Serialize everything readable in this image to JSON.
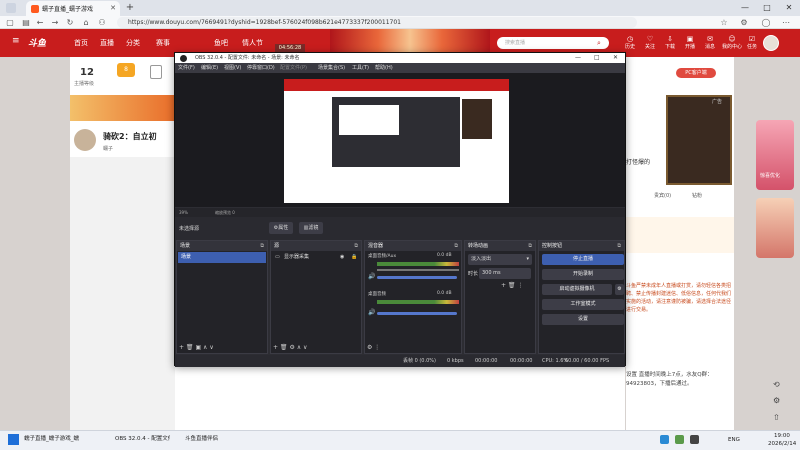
{
  "browser": {
    "tab_title": "蠕子直播_蠕子游戏",
    "url": "https://www.douyu.com/7669491?dyshid=1928bef-576024f098b621e4773337f200011701"
  },
  "site": {
    "logo": "斗鱼",
    "nav": [
      "首页",
      "直播",
      "分类",
      "赛事",
      "游戏",
      "鱼吧",
      "鱼吧",
      "情人节"
    ],
    "search_placeholder": "搜索直播",
    "header_icons": [
      "历史",
      "关注",
      "下载",
      "开播",
      "消息",
      "我的中心",
      "任务"
    ],
    "live_badge": "04:56:28",
    "level": "12",
    "level_label": "主播等级",
    "badge_count": "8",
    "streamer_title": "骑砍2：自立初",
    "streamer_name": "蠕子",
    "pc_link": "PC客户端",
    "right_tabs": [
      "贵宾(0)",
      "钻粉"
    ],
    "pc_label": "广告",
    "game_label": "打怪爆的",
    "side_ad_text": "惊喜优化",
    "chat_notice": "设置  直播时间晚上7点，水友Q群：94923803，下播后通过。",
    "chat_rules": "斗鱼严禁未成年人直播或打赏，请勿轻信各类招聘、禁止传播封建迷信、低俗信息，任何代我们实施的活动，请注意谨防被骗，请选择合法途径进行交易。"
  },
  "obs": {
    "title": "OBS 32.0.4 - 配置文件: 未命名 - 场景: 未命名",
    "menu": [
      "文件(F)",
      "编辑(E)",
      "视图(V)",
      "停靠窗口(D)",
      "配置文件(P)",
      "场景集合(S)",
      "工具(T)",
      "帮助(H)"
    ],
    "strip_left": "39%",
    "strip_mid": "缩放预览 0",
    "no_source": "未选择源",
    "properties": "属性",
    "filters": "滤镜",
    "panels": {
      "scenes": {
        "title": "场景",
        "items": [
          "场景"
        ]
      },
      "sources": {
        "title": "源",
        "items": [
          "显示器采集"
        ]
      },
      "mixer": {
        "title": "混音器",
        "tracks": [
          {
            "name": "桌面音频/Aux",
            "db": "0.0 dB"
          },
          {
            "name": "桌面音频",
            "db": "0.0 dB"
          }
        ]
      },
      "transitions": {
        "title": "转场动画",
        "type": "淡入淡出",
        "duration_label": "时长",
        "duration": "300 ms"
      },
      "controls": {
        "title": "控制按钮",
        "buttons": [
          "停止直播",
          "开始录制",
          "启动虚拟摄像机",
          "工作室模式",
          "设置"
        ]
      }
    },
    "status": {
      "frames": "丢帧 0 (0.0%)",
      "kbps": "0 kbps",
      "rec": "00:00:00",
      "stream": "00:00:00",
      "cpu": "CPU: 1.6%",
      "fps": "60.00 / 60.00 FPS"
    }
  },
  "taskbar": {
    "items": [
      "蠕子直播_蠕子游戏_蠕",
      "OBS 32.0.4 - 配置文件: 3",
      "斗鱼直播伴侣"
    ],
    "lang": "ENG",
    "time": "19:00",
    "date": "2026/2/14"
  },
  "colors": {
    "brand_red": "#c81d1d",
    "obs_bg": "#2d2d33",
    "obs_active": "#3d5fb0"
  }
}
